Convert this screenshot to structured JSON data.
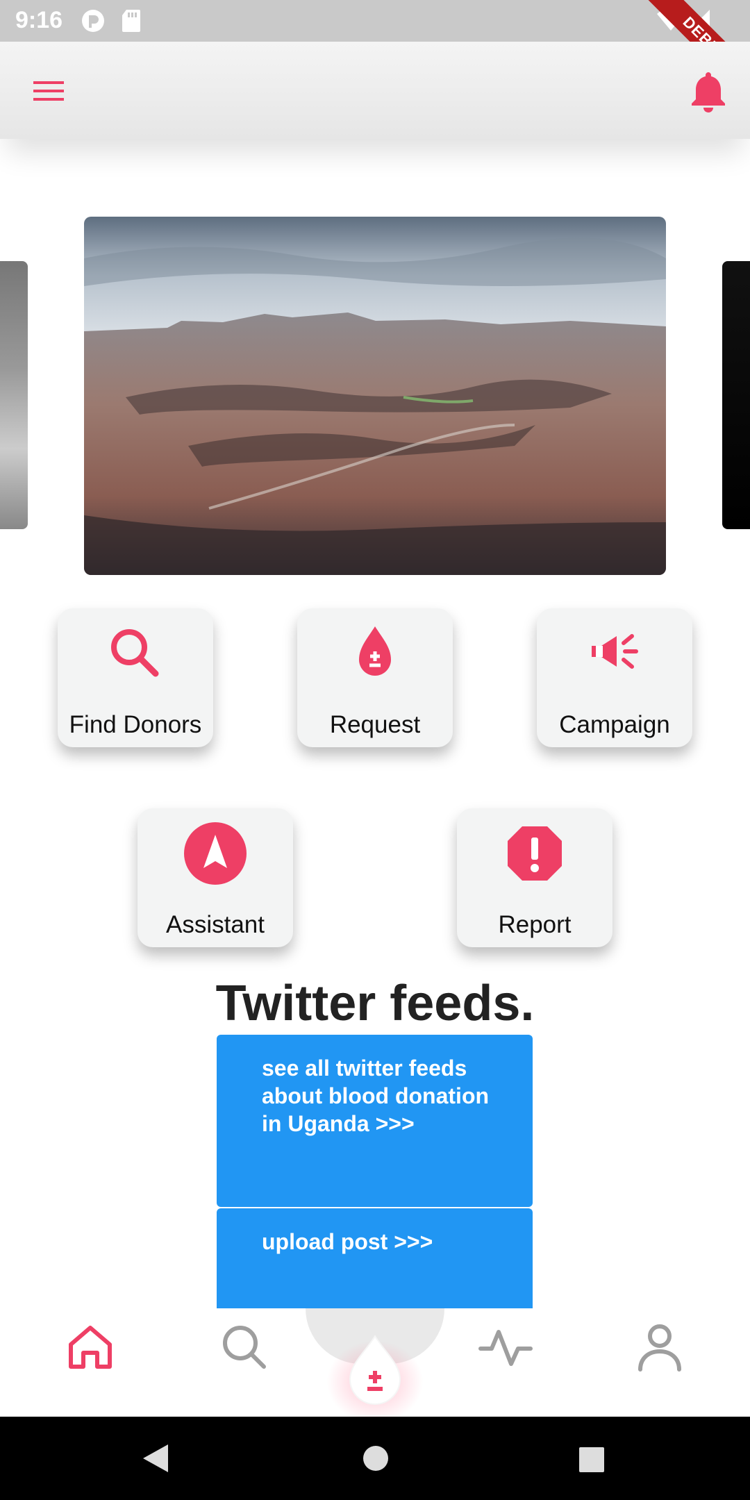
{
  "status_bar": {
    "time": "9:16",
    "icons": [
      "pocket-icon",
      "sd-card-icon",
      "wifi-icon",
      "signal-icon",
      "battery-icon"
    ],
    "debug_banner": "DEBUG"
  },
  "app_bar": {
    "menu_icon": "hamburger-menu-icon",
    "notification_icon": "bell-icon"
  },
  "carousel": {
    "main_image": "canyon-landscape-photo"
  },
  "actions": [
    {
      "label": "Find Donors",
      "icon": "search-icon"
    },
    {
      "label": "Request",
      "icon": "blood-drop-plus-minus-icon"
    },
    {
      "label": "Campaign",
      "icon": "megaphone-icon"
    },
    {
      "label": "Assistant",
      "icon": "navigation-arrow-icon"
    },
    {
      "label": "Report",
      "icon": "alert-octagon-icon"
    }
  ],
  "twitter": {
    "title": "Twitter feeds.",
    "see_all": "see all twitter feeds about blood donation in Uganda >>>",
    "upload": "upload post >>>"
  },
  "bottom_nav": {
    "items": [
      "home-icon",
      "search-icon",
      "blood-drop-icon",
      "activity-icon",
      "profile-icon"
    ],
    "active": "home"
  },
  "colors": {
    "accent": "#ee3f65",
    "blue_card": "#2196f3",
    "tile_bg": "#f3f4f4",
    "nav_inactive": "#9e9e9e"
  }
}
